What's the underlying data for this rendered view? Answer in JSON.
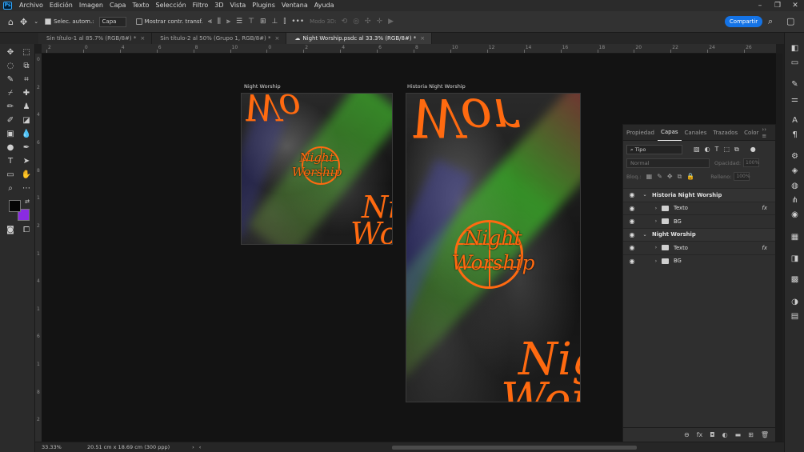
{
  "menu": {
    "app_logo": "Ps",
    "items": [
      "Archivo",
      "Edición",
      "Imagen",
      "Capa",
      "Texto",
      "Selección",
      "Filtro",
      "3D",
      "Vista",
      "Plugins",
      "Ventana",
      "Ayuda"
    ]
  },
  "options": {
    "auto_select_label": "Selec. autom.:",
    "auto_select_value": "Capa",
    "show_transform_label": "Mostrar contr. transf.",
    "mode3d_label": "Modo 3D:",
    "share_label": "Compartir"
  },
  "tabs": [
    {
      "label": "Sin título-1 al 85.7% (RGB/8#) *",
      "active": false
    },
    {
      "label": "Sin título-2 al 50% (Grupo 1, RGB/8#) *",
      "active": false
    },
    {
      "label": "Night Worship.psdc al 33.3% (RGB/8#) *",
      "active": true
    }
  ],
  "ruler": {
    "top_labels": [
      "2",
      "0",
      "4",
      "6",
      "8",
      "10",
      "0",
      "2",
      "4",
      "6",
      "8",
      "10",
      "12",
      "14",
      "16",
      "18",
      "20",
      "22",
      "24",
      "26"
    ],
    "left_labels": [
      "0",
      "2",
      "4",
      "6",
      "8",
      "1",
      "2",
      "1",
      "4",
      "1",
      "6",
      "1",
      "8",
      "2"
    ]
  },
  "artboards": {
    "small": {
      "label": "Night  Worship",
      "logo_line1": "Night",
      "logo_line2": "Worship",
      "headline_top": "Wo",
      "headline_bottom_1": "Ni",
      "headline_bottom_2": "Wo"
    },
    "story": {
      "label": "Historia  Night  Worship",
      "logo_line1": "Night",
      "logo_line2": "Worship",
      "headline_top": "Wor",
      "headline_bottom_1": "Nig",
      "headline_bottom_2": "Wors"
    }
  },
  "layers_panel": {
    "tabs": [
      "Propiedad",
      "Capas",
      "Canales",
      "Trazados",
      "Color"
    ],
    "active_tab": "Capas",
    "filter_type": "Tipo",
    "blend_mode": "Normal",
    "opacity_label": "Opacidad:",
    "opacity_value": "100%",
    "lock_label": "Bloq.:",
    "fill_label": "Relleno:",
    "fill_value": "100%",
    "layers": [
      {
        "name": "Historia  Night  Worship",
        "type": "artboard"
      },
      {
        "name": "Texto",
        "type": "group",
        "fx": "fx"
      },
      {
        "name": "BG",
        "type": "group"
      },
      {
        "name": "Night  Worship",
        "type": "artboard"
      },
      {
        "name": "Texto",
        "type": "group",
        "fx": "fx"
      },
      {
        "name": "BG",
        "type": "group"
      }
    ]
  },
  "status": {
    "zoom": "33.33%",
    "doc_size": "20.51 cm x 18.69 cm (300 ppp)"
  },
  "colors": {
    "accent_orange": "#ff6a10",
    "background_swatch": "#8a2be2",
    "share_blue": "#1473e6"
  }
}
